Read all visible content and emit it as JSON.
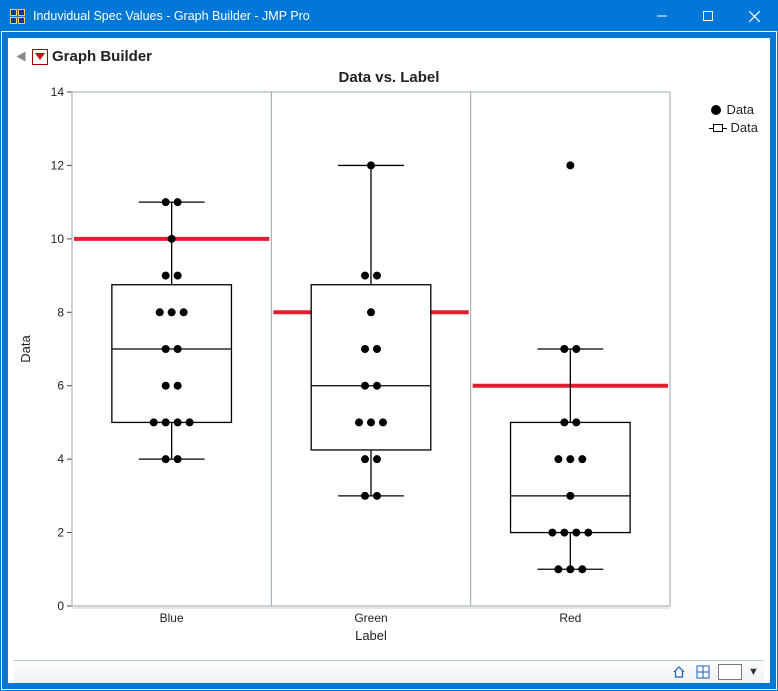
{
  "window": {
    "title": "Induvidual Spec Values - Graph Builder - JMP Pro",
    "minimize_label": "Minimize",
    "maximize_label": "Maximize",
    "close_label": "Close"
  },
  "section": {
    "title": "Graph Builder"
  },
  "chart": {
    "title": "Data vs. Label",
    "xlabel": "Label",
    "ylabel": "Data"
  },
  "legend": {
    "item1": "Data",
    "item2": "Data"
  },
  "statusbar": {
    "home": "Home",
    "grid": "Layout",
    "swatch": "Background",
    "menu": "▼"
  },
  "chart_data": {
    "type": "boxplot",
    "title": "Data vs. Label",
    "xlabel": "Label",
    "ylabel": "Data",
    "ylim": [
      0,
      14
    ],
    "yticks": [
      0,
      2,
      4,
      6,
      8,
      10,
      12,
      14
    ],
    "categories": [
      "Blue",
      "Green",
      "Red"
    ],
    "series": [
      {
        "name": "Blue",
        "box": {
          "q1": 5.0,
          "median": 7.0,
          "q3": 8.75,
          "whisker_low": 4.0,
          "whisker_high": 11.0
        },
        "spec_line": 10.0,
        "points": [
          {
            "x_offset": -0.03,
            "y": 11.0
          },
          {
            "x_offset": 0.03,
            "y": 11.0
          },
          {
            "x_offset": 0.0,
            "y": 10.0
          },
          {
            "x_offset": -0.03,
            "y": 9.0
          },
          {
            "x_offset": 0.03,
            "y": 9.0
          },
          {
            "x_offset": -0.06,
            "y": 8.0
          },
          {
            "x_offset": 0.0,
            "y": 8.0
          },
          {
            "x_offset": 0.06,
            "y": 8.0
          },
          {
            "x_offset": -0.03,
            "y": 7.0
          },
          {
            "x_offset": 0.03,
            "y": 7.0
          },
          {
            "x_offset": -0.03,
            "y": 6.0
          },
          {
            "x_offset": 0.03,
            "y": 6.0
          },
          {
            "x_offset": -0.09,
            "y": 5.0
          },
          {
            "x_offset": -0.03,
            "y": 5.0
          },
          {
            "x_offset": 0.03,
            "y": 5.0
          },
          {
            "x_offset": 0.09,
            "y": 5.0
          },
          {
            "x_offset": -0.03,
            "y": 4.0
          },
          {
            "x_offset": 0.03,
            "y": 4.0
          }
        ]
      },
      {
        "name": "Green",
        "box": {
          "q1": 4.25,
          "median": 6.0,
          "q3": 8.75,
          "whisker_low": 3.0,
          "whisker_high": 12.0
        },
        "spec_line": 8.0,
        "points": [
          {
            "x_offset": 0.0,
            "y": 12.0
          },
          {
            "x_offset": -0.03,
            "y": 9.0
          },
          {
            "x_offset": 0.03,
            "y": 9.0
          },
          {
            "x_offset": 0.0,
            "y": 8.0
          },
          {
            "x_offset": -0.03,
            "y": 7.0
          },
          {
            "x_offset": 0.03,
            "y": 7.0
          },
          {
            "x_offset": -0.03,
            "y": 6.0
          },
          {
            "x_offset": 0.03,
            "y": 6.0
          },
          {
            "x_offset": -0.06,
            "y": 5.0
          },
          {
            "x_offset": 0.0,
            "y": 5.0
          },
          {
            "x_offset": 0.06,
            "y": 5.0
          },
          {
            "x_offset": -0.03,
            "y": 4.0
          },
          {
            "x_offset": 0.03,
            "y": 4.0
          },
          {
            "x_offset": -0.03,
            "y": 3.0
          },
          {
            "x_offset": 0.03,
            "y": 3.0
          }
        ]
      },
      {
        "name": "Red",
        "box": {
          "q1": 2.0,
          "median": 3.0,
          "q3": 5.0,
          "whisker_low": 1.0,
          "whisker_high": 7.0
        },
        "spec_line": 6.0,
        "points": [
          {
            "x_offset": 0.0,
            "y": 12.0
          },
          {
            "x_offset": -0.03,
            "y": 7.0
          },
          {
            "x_offset": 0.03,
            "y": 7.0
          },
          {
            "x_offset": -0.03,
            "y": 5.0
          },
          {
            "x_offset": 0.03,
            "y": 5.0
          },
          {
            "x_offset": -0.06,
            "y": 4.0
          },
          {
            "x_offset": 0.0,
            "y": 4.0
          },
          {
            "x_offset": 0.06,
            "y": 4.0
          },
          {
            "x_offset": 0.0,
            "y": 3.0
          },
          {
            "x_offset": -0.09,
            "y": 2.0
          },
          {
            "x_offset": -0.03,
            "y": 2.0
          },
          {
            "x_offset": 0.03,
            "y": 2.0
          },
          {
            "x_offset": 0.09,
            "y": 2.0
          },
          {
            "x_offset": -0.06,
            "y": 1.0
          },
          {
            "x_offset": 0.0,
            "y": 1.0
          },
          {
            "x_offset": 0.06,
            "y": 1.0
          }
        ]
      }
    ],
    "legend": [
      "Data",
      "Data"
    ]
  }
}
